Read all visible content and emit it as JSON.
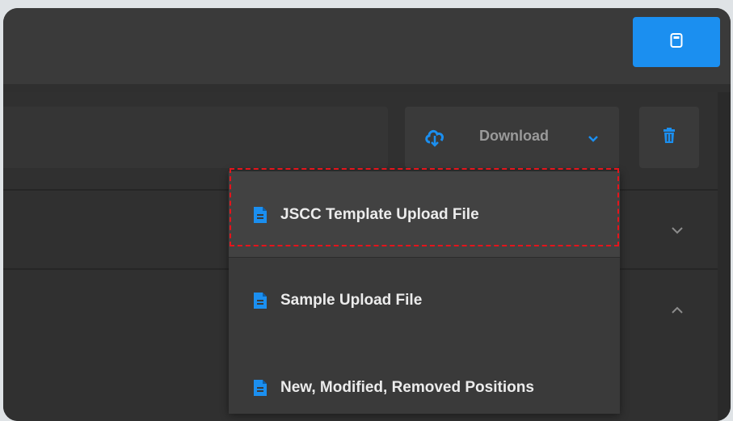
{
  "toolbar": {
    "primary_action_icon": "calculator-icon",
    "accent_color": "#1b8ff0"
  },
  "actions": {
    "download_label": "Download",
    "download_icon": "cloud-download-icon",
    "dropdown_icon": "chevron-down-icon",
    "delete_icon": "trash-icon"
  },
  "download_menu": {
    "items": [
      {
        "label": "JSCC Template Upload File",
        "icon": "file-icon",
        "highlighted": true
      },
      {
        "label": "Sample Upload File",
        "icon": "file-icon",
        "highlighted": false
      },
      {
        "label": "New, Modified, Removed Positions",
        "icon": "file-icon",
        "highlighted": false
      }
    ]
  },
  "rows": [
    {
      "toggle_icon": "chevron-down-icon"
    },
    {
      "toggle_icon": "chevron-up-icon"
    }
  ],
  "colors": {
    "background": "#2f2f2f",
    "menu_background": "#3a3a3a",
    "icon_blue": "#1b8ff0",
    "focus_outline": "#e5141b"
  }
}
